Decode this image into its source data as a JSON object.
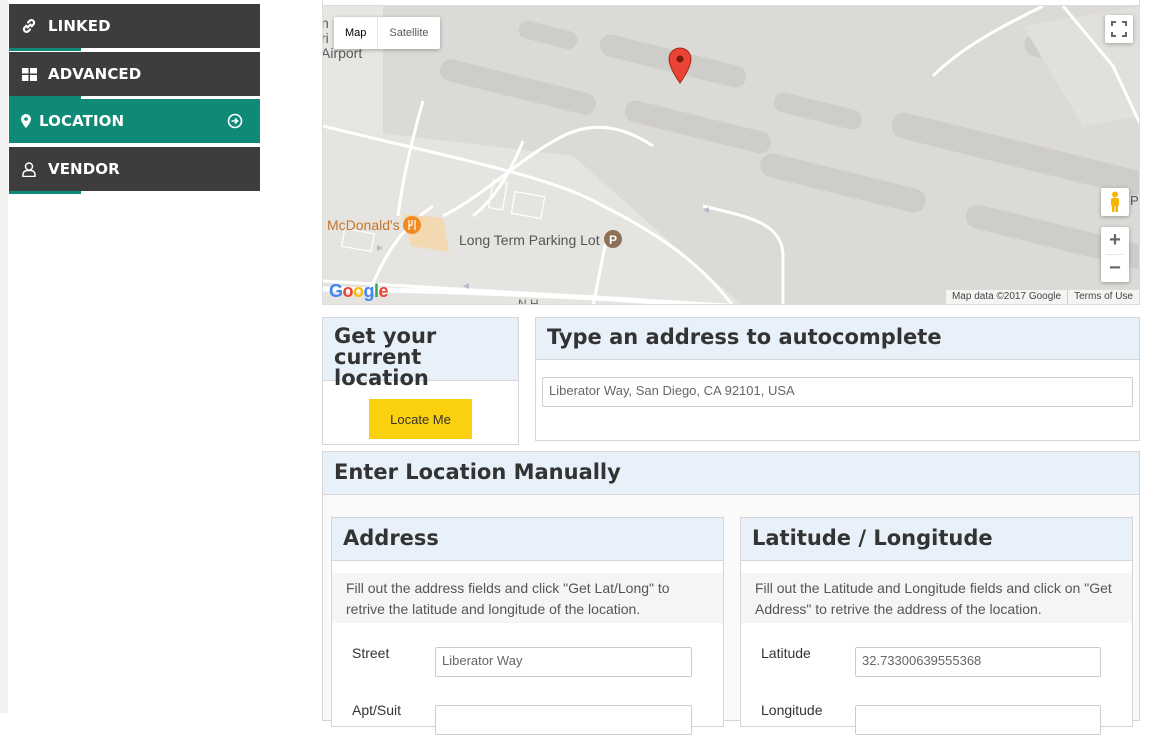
{
  "sidebar": {
    "items": [
      {
        "label": "LINKED",
        "icon": "link-icon"
      },
      {
        "label": "ADVANCED",
        "icon": "grid-icon"
      },
      {
        "label": "LOCATION",
        "icon": "map-pin-icon",
        "active": true
      },
      {
        "label": "VENDOR",
        "icon": "user-icon"
      }
    ],
    "active_color": "#0e8a76",
    "item_color": "#3d3d3d"
  },
  "map": {
    "type_buttons": {
      "map": "Map",
      "satellite": "Satellite"
    },
    "labels": {
      "airport_partial": "n\nri\nAirport",
      "mcdonalds": "McDonald's",
      "parking": "Long Term Parking Lot",
      "street_partial": "N H",
      "right_edge": "P"
    },
    "footer": {
      "data": "Map data ©2017 Google",
      "terms": "Terms of Use"
    },
    "logo": "Google",
    "zoom_in": "+",
    "zoom_out": "−"
  },
  "current_location": {
    "title": "Get your current location",
    "button": "Locate Me"
  },
  "autocomplete": {
    "title": "Type an address to autocomplete",
    "placeholder": "Liberator Way, San Diego, CA 92101, USA"
  },
  "manual": {
    "title": "Enter Location Manually",
    "address": {
      "title": "Address",
      "help": "Fill out the address fields and click \"Get Lat/Long\" to retrive the latitude and longitude of the location.",
      "street_label": "Street",
      "street_value": "Liberator Way",
      "apt_label": "Apt/Suit"
    },
    "latlong": {
      "title": "Latitude / Longitude",
      "help": "Fill out the Latitude and Longitude fields and click on \"Get Address\" to retrive the address of the location.",
      "lat_label": "Latitude",
      "lat_value": "32.73300639555368",
      "long_label": "Longitude"
    }
  },
  "colors": {
    "button_yellow": "#fbd10f",
    "panel_head": "#e8f1fa"
  }
}
